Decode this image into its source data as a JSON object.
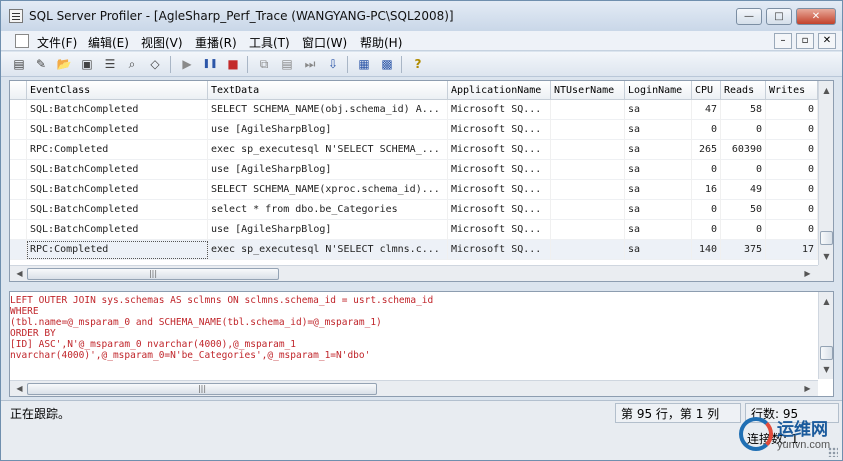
{
  "window": {
    "title": "SQL Server Profiler - [AgleSharp_Perf_Trace (WANGYANG-PC\\SQL2008)]",
    "controls": {
      "minimize": "—",
      "maximize": "□",
      "close": "✕"
    },
    "mdi_controls": {
      "minimize": "–",
      "restore": "▫",
      "close": "✕"
    }
  },
  "menubar": {
    "items": [
      {
        "label": "文件(F)"
      },
      {
        "label": "编辑(E)"
      },
      {
        "label": "视图(V)"
      },
      {
        "label": "重播(R)"
      },
      {
        "label": "工具(T)"
      },
      {
        "label": "窗口(W)"
      },
      {
        "label": "帮助(H)"
      }
    ]
  },
  "toolbar": {
    "icons": [
      "new-trace-icon",
      "new-file-icon",
      "open-icon",
      "save-icon",
      "properties-icon",
      "find-icon",
      "clear-icon",
      "run-icon",
      "pause-icon",
      "stop-icon",
      "replay-icon",
      "step-icon",
      "run-to-cursor-icon",
      "auto-scroll-icon",
      "activity-monitor-icon",
      "tuning-advisor-icon",
      "help-icon"
    ],
    "glyphs": [
      "▤",
      "✎",
      "📂",
      "▣",
      "☰",
      "⌕",
      "◇",
      "▶",
      "❚❚",
      "■",
      "⧉",
      "▤",
      "⏭",
      "⇩",
      "▦",
      "▩",
      "?"
    ]
  },
  "grid": {
    "columns": [
      "EventClass",
      "TextData",
      "ApplicationName",
      "NTUserName",
      "LoginName",
      "CPU",
      "Reads",
      "Writes"
    ],
    "rows": [
      {
        "event": "SQL:BatchCompleted",
        "text": "SELECT SCHEMA_NAME(obj.schema_id) A...",
        "app": "Microsoft SQ...",
        "nt": "",
        "login": "sa",
        "cpu": "47",
        "reads": "58",
        "writes": "0"
      },
      {
        "event": "SQL:BatchCompleted",
        "text": "use [AgileSharpBlog]",
        "app": "Microsoft SQ...",
        "nt": "",
        "login": "sa",
        "cpu": "0",
        "reads": "0",
        "writes": "0"
      },
      {
        "event": "RPC:Completed",
        "text": "exec sp_executesql N'SELECT SCHEMA_...",
        "app": "Microsoft SQ...",
        "nt": "",
        "login": "sa",
        "cpu": "265",
        "reads": "60390",
        "writes": "0"
      },
      {
        "event": "SQL:BatchCompleted",
        "text": "use [AgileSharpBlog]",
        "app": "Microsoft SQ...",
        "nt": "",
        "login": "sa",
        "cpu": "0",
        "reads": "0",
        "writes": "0"
      },
      {
        "event": "SQL:BatchCompleted",
        "text": "SELECT SCHEMA_NAME(xproc.schema_id)...",
        "app": "Microsoft SQ...",
        "nt": "",
        "login": "sa",
        "cpu": "16",
        "reads": "49",
        "writes": "0"
      },
      {
        "event": "SQL:BatchCompleted",
        "text": "select * from  dbo.be_Categories",
        "app": "Microsoft SQ...",
        "nt": "",
        "login": "sa",
        "cpu": "0",
        "reads": "50",
        "writes": "0"
      },
      {
        "event": "SQL:BatchCompleted",
        "text": "use [AgileSharpBlog]",
        "app": "Microsoft SQ...",
        "nt": "",
        "login": "sa",
        "cpu": "0",
        "reads": "0",
        "writes": "0"
      },
      {
        "event": "RPC:Completed",
        "text": "exec sp_executesql N'SELECT clmns.c...",
        "app": "Microsoft SQ...",
        "nt": "",
        "login": "sa",
        "cpu": "140",
        "reads": "375",
        "writes": "17"
      }
    ],
    "selected_row": 7,
    "hscroll_grip": "|||"
  },
  "detail": {
    "lines": [
      "LEFT OUTER JOIN sys.schemas AS sclmns ON sclmns.schema_id = usrt.schema_id",
      "WHERE",
      "(tbl.name=@_msparam_0 and SCHEMA_NAME(tbl.schema_id)=@_msparam_1)",
      "ORDER BY",
      "[ID] ASC',N'@_msparam_0 nvarchar(4000),@_msparam_1",
      "nvarchar(4000)',@_msparam_0=N'be_Categories',@_msparam_1=N'dbo'"
    ],
    "hscroll_grip": "|||"
  },
  "statusbar": {
    "status": "正在跟踪。",
    "position": "第 95 行，第 1 列",
    "rows": "行数: 95",
    "connections": "连接数: 1"
  },
  "watermark": {
    "title": "运维网",
    "url": "yunvn.com"
  }
}
